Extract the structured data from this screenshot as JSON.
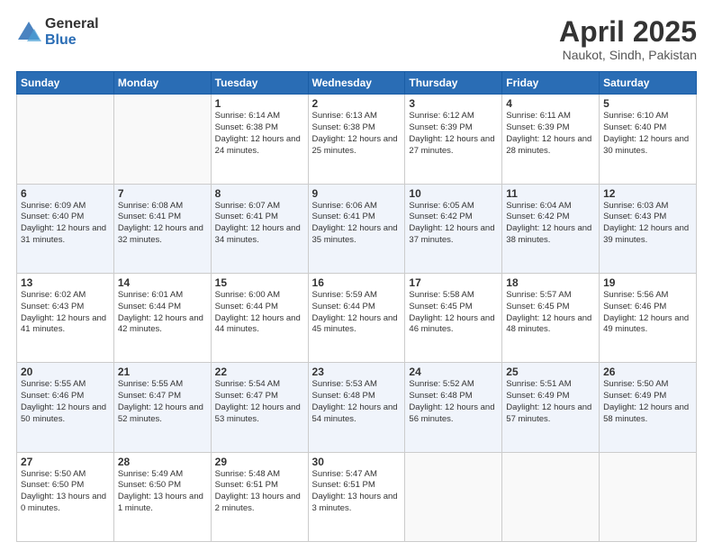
{
  "header": {
    "logo_general": "General",
    "logo_blue": "Blue",
    "month_title": "April 2025",
    "location": "Naukot, Sindh, Pakistan"
  },
  "days_of_week": [
    "Sunday",
    "Monday",
    "Tuesday",
    "Wednesday",
    "Thursday",
    "Friday",
    "Saturday"
  ],
  "weeks": [
    [
      {
        "day": "",
        "info": ""
      },
      {
        "day": "",
        "info": ""
      },
      {
        "day": "1",
        "info": "Sunrise: 6:14 AM\nSunset: 6:38 PM\nDaylight: 12 hours and 24 minutes."
      },
      {
        "day": "2",
        "info": "Sunrise: 6:13 AM\nSunset: 6:38 PM\nDaylight: 12 hours and 25 minutes."
      },
      {
        "day": "3",
        "info": "Sunrise: 6:12 AM\nSunset: 6:39 PM\nDaylight: 12 hours and 27 minutes."
      },
      {
        "day": "4",
        "info": "Sunrise: 6:11 AM\nSunset: 6:39 PM\nDaylight: 12 hours and 28 minutes."
      },
      {
        "day": "5",
        "info": "Sunrise: 6:10 AM\nSunset: 6:40 PM\nDaylight: 12 hours and 30 minutes."
      }
    ],
    [
      {
        "day": "6",
        "info": "Sunrise: 6:09 AM\nSunset: 6:40 PM\nDaylight: 12 hours and 31 minutes."
      },
      {
        "day": "7",
        "info": "Sunrise: 6:08 AM\nSunset: 6:41 PM\nDaylight: 12 hours and 32 minutes."
      },
      {
        "day": "8",
        "info": "Sunrise: 6:07 AM\nSunset: 6:41 PM\nDaylight: 12 hours and 34 minutes."
      },
      {
        "day": "9",
        "info": "Sunrise: 6:06 AM\nSunset: 6:41 PM\nDaylight: 12 hours and 35 minutes."
      },
      {
        "day": "10",
        "info": "Sunrise: 6:05 AM\nSunset: 6:42 PM\nDaylight: 12 hours and 37 minutes."
      },
      {
        "day": "11",
        "info": "Sunrise: 6:04 AM\nSunset: 6:42 PM\nDaylight: 12 hours and 38 minutes."
      },
      {
        "day": "12",
        "info": "Sunrise: 6:03 AM\nSunset: 6:43 PM\nDaylight: 12 hours and 39 minutes."
      }
    ],
    [
      {
        "day": "13",
        "info": "Sunrise: 6:02 AM\nSunset: 6:43 PM\nDaylight: 12 hours and 41 minutes."
      },
      {
        "day": "14",
        "info": "Sunrise: 6:01 AM\nSunset: 6:44 PM\nDaylight: 12 hours and 42 minutes."
      },
      {
        "day": "15",
        "info": "Sunrise: 6:00 AM\nSunset: 6:44 PM\nDaylight: 12 hours and 44 minutes."
      },
      {
        "day": "16",
        "info": "Sunrise: 5:59 AM\nSunset: 6:44 PM\nDaylight: 12 hours and 45 minutes."
      },
      {
        "day": "17",
        "info": "Sunrise: 5:58 AM\nSunset: 6:45 PM\nDaylight: 12 hours and 46 minutes."
      },
      {
        "day": "18",
        "info": "Sunrise: 5:57 AM\nSunset: 6:45 PM\nDaylight: 12 hours and 48 minutes."
      },
      {
        "day": "19",
        "info": "Sunrise: 5:56 AM\nSunset: 6:46 PM\nDaylight: 12 hours and 49 minutes."
      }
    ],
    [
      {
        "day": "20",
        "info": "Sunrise: 5:55 AM\nSunset: 6:46 PM\nDaylight: 12 hours and 50 minutes."
      },
      {
        "day": "21",
        "info": "Sunrise: 5:55 AM\nSunset: 6:47 PM\nDaylight: 12 hours and 52 minutes."
      },
      {
        "day": "22",
        "info": "Sunrise: 5:54 AM\nSunset: 6:47 PM\nDaylight: 12 hours and 53 minutes."
      },
      {
        "day": "23",
        "info": "Sunrise: 5:53 AM\nSunset: 6:48 PM\nDaylight: 12 hours and 54 minutes."
      },
      {
        "day": "24",
        "info": "Sunrise: 5:52 AM\nSunset: 6:48 PM\nDaylight: 12 hours and 56 minutes."
      },
      {
        "day": "25",
        "info": "Sunrise: 5:51 AM\nSunset: 6:49 PM\nDaylight: 12 hours and 57 minutes."
      },
      {
        "day": "26",
        "info": "Sunrise: 5:50 AM\nSunset: 6:49 PM\nDaylight: 12 hours and 58 minutes."
      }
    ],
    [
      {
        "day": "27",
        "info": "Sunrise: 5:50 AM\nSunset: 6:50 PM\nDaylight: 13 hours and 0 minutes."
      },
      {
        "day": "28",
        "info": "Sunrise: 5:49 AM\nSunset: 6:50 PM\nDaylight: 13 hours and 1 minute."
      },
      {
        "day": "29",
        "info": "Sunrise: 5:48 AM\nSunset: 6:51 PM\nDaylight: 13 hours and 2 minutes."
      },
      {
        "day": "30",
        "info": "Sunrise: 5:47 AM\nSunset: 6:51 PM\nDaylight: 13 hours and 3 minutes."
      },
      {
        "day": "",
        "info": ""
      },
      {
        "day": "",
        "info": ""
      },
      {
        "day": "",
        "info": ""
      }
    ]
  ]
}
